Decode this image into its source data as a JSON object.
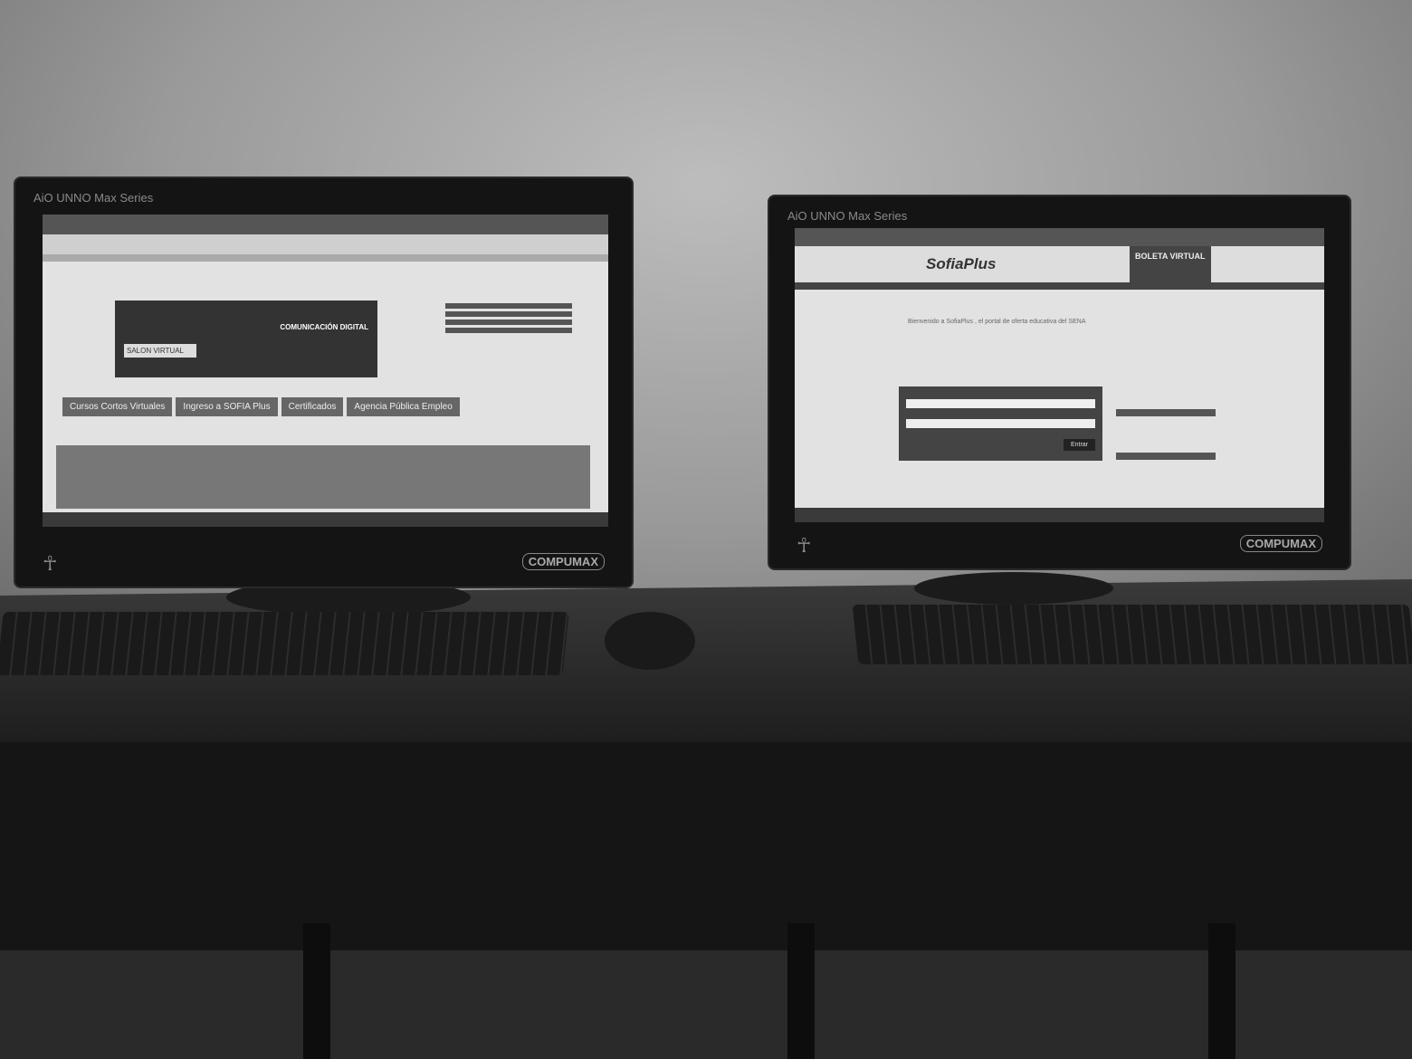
{
  "left_monitor": {
    "brand": "AiO UNNO Max Series",
    "maker": "COMPUMAX",
    "site": {
      "banner_title": "COMUNICACIÓN DIGITAL",
      "banner_label": "SALON VIRTUAL",
      "quick_links": [
        "Cursos Cortos Virtuales",
        "Ingreso a SOFIA Plus",
        "Certificados",
        "Agencia Pública Empleo"
      ]
    }
  },
  "right_monitor": {
    "brand": "AiO UNNO Max Series",
    "maker": "COMPUMAX",
    "site": {
      "logo": "SofiaPlus",
      "banner": "BOLETA VIRTUAL",
      "welcome": "Bienvenido a SofiaPlus , el portal de oferta educativa del SENA",
      "login_button": "Entrar"
    }
  }
}
